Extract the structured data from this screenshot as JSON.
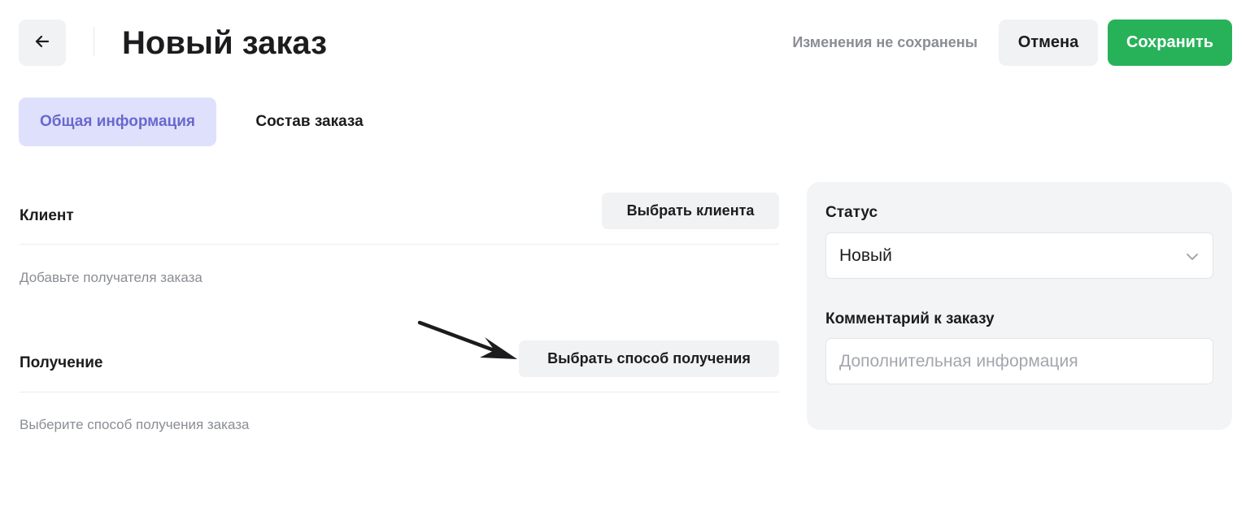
{
  "header": {
    "back_icon": "arrow-left-icon",
    "title": "Новый заказ",
    "unsaved_status": "Изменения не сохранены",
    "cancel_label": "Отмена",
    "save_label": "Сохранить"
  },
  "tabs": [
    {
      "label": "Общая информация",
      "active": true
    },
    {
      "label": "Состав заказа",
      "active": false
    }
  ],
  "client_section": {
    "title": "Клиент",
    "button_label": "Выбрать клиента",
    "hint": "Добавьте получателя заказа"
  },
  "delivery_section": {
    "title": "Получение",
    "button_label": "Выбрать способ получения",
    "hint": "Выберите способ получения заказа"
  },
  "side_panel": {
    "status_label": "Статус",
    "status_value": "Новый",
    "status_icon": "chevron-down-icon",
    "comment_label": "Комментарий к заказу",
    "comment_value": "",
    "comment_placeholder": "Дополнительная информация"
  },
  "colors": {
    "accent_primary": "#27b25a",
    "tab_active_bg": "#dfe1fc",
    "tab_active_text": "#6a67cf",
    "muted_text": "#8a8d94",
    "panel_bg": "#f3f4f6"
  }
}
